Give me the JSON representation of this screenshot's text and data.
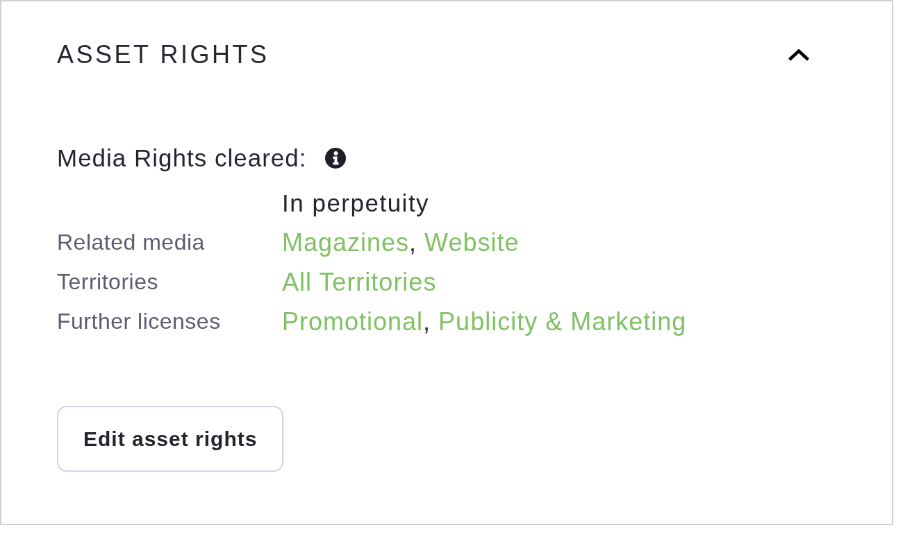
{
  "panel": {
    "title": "ASSET RIGHTS",
    "expanded": true
  },
  "media_rights": {
    "label": "Media Rights cleared:",
    "period": "In perpetuity",
    "rows": [
      {
        "label": "Related media",
        "parts": [
          {
            "kind": "link",
            "text": "Magazines"
          },
          {
            "kind": "text",
            "text": ","
          },
          {
            "kind": "link",
            "text": "Website"
          }
        ]
      },
      {
        "label": "Territories",
        "parts": [
          {
            "kind": "link",
            "text": "All Territories"
          }
        ]
      },
      {
        "label": "Further licenses",
        "parts": [
          {
            "kind": "link",
            "text": "Promotional"
          },
          {
            "kind": "text",
            "text": ","
          },
          {
            "kind": "link",
            "text": "Publicity & Marketing"
          }
        ]
      }
    ]
  },
  "buttons": [
    {
      "label": "Edit asset rights"
    }
  ]
}
